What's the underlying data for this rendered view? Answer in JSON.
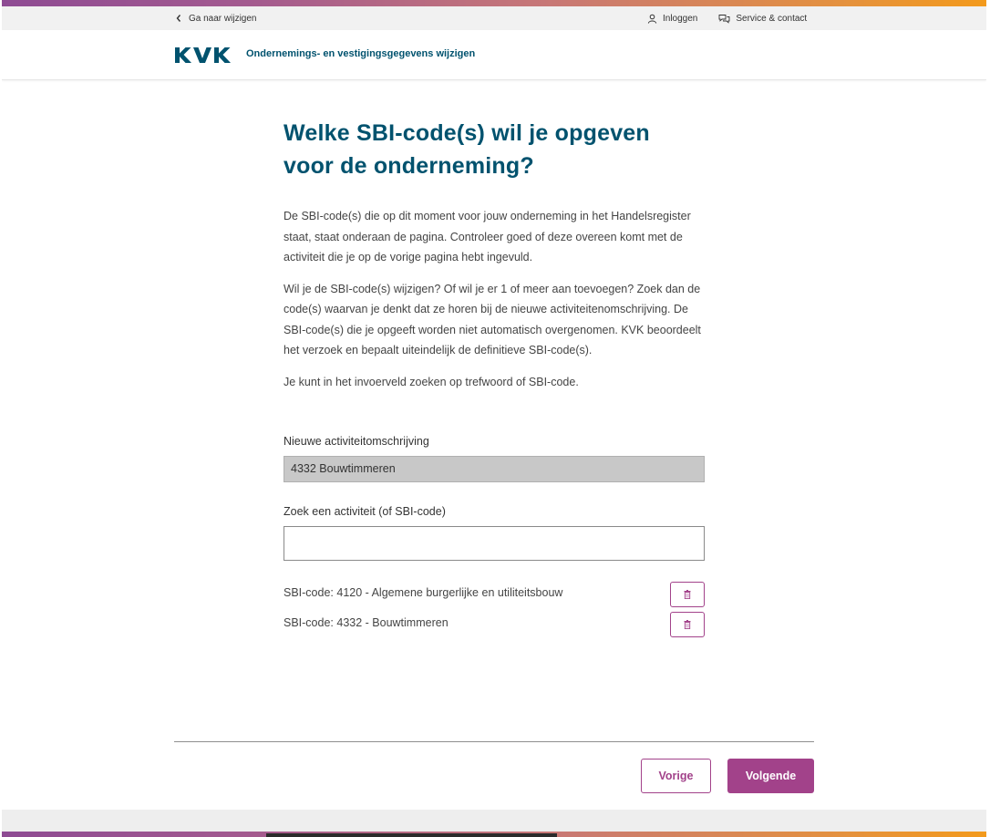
{
  "util": {
    "back_label": "Ga naar wijzigen",
    "login_label": "Inloggen",
    "service_label": "Service & contact"
  },
  "header": {
    "logo_text": "KVK",
    "title": "Ondernemings- en vestigingsgegevens wijzigen"
  },
  "main": {
    "heading": "Welke SBI-code(s) wil je opgeven voor de onderneming?",
    "paragraph1": "De SBI-code(s) die op dit moment voor jouw onderneming in het Handelsregister staat, staat onderaan de pagina. Controleer goed of deze overeen komt met de activiteit die je op de vorige pagina hebt ingevuld.",
    "paragraph2": "Wil je de SBI-code(s) wijzigen? Of wil je er 1 of meer aan toevoegen? Zoek dan de code(s) waarvan je denkt dat ze horen bij de nieuwe activiteitenomschrijving. De SBI-code(s) die je opgeeft worden niet automatisch overgenomen. KVK beoordeelt het verzoek en bepaalt uiteindelijk de definitieve SBI-code(s).",
    "paragraph3": "Je kunt in het invoerveld zoeken op trefwoord of SBI-code."
  },
  "form": {
    "activity_label": "Nieuwe activiteitomschrijving",
    "activity_value": "4332 Bouwtimmeren",
    "search_label": "Zoek een activiteit (of SBI-code)",
    "search_value": ""
  },
  "sbi_codes": [
    {
      "text": "SBI-code: 4120 - Algemene burgerlijke en utiliteitsbouw"
    },
    {
      "text": "SBI-code: 4332 - Bouwtimmeren"
    }
  ],
  "nav": {
    "prev_label": "Vorige",
    "next_label": "Volgende"
  },
  "colors": {
    "brand_blue": "#00526e",
    "accent_purple": "#a2428a"
  },
  "icons": {
    "back": "chevron-left-icon",
    "login": "user-icon",
    "service": "chat-bubbles-icon",
    "delete": "trash-icon"
  }
}
